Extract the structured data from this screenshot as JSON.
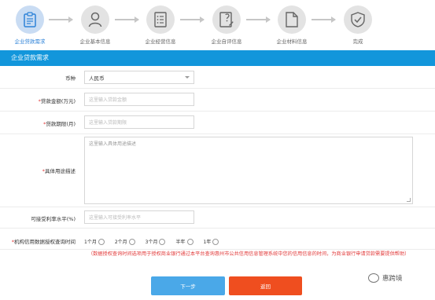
{
  "steps": [
    {
      "label": "企业贷款需求",
      "icon": "clipboard-icon",
      "active": true
    },
    {
      "label": "企业基本信息",
      "icon": "person-icon",
      "active": false
    },
    {
      "label": "企业经营信息",
      "icon": "list-document-icon",
      "active": false
    },
    {
      "label": "企业自评信息",
      "icon": "edit-document-icon",
      "active": false
    },
    {
      "label": "企业材料信息",
      "icon": "file-icon",
      "active": false
    },
    {
      "label": "完成",
      "icon": "shield-check-icon",
      "active": false
    }
  ],
  "section_title": "企业贷款需求",
  "form": {
    "currency": {
      "label": "币种",
      "value": "人民币"
    },
    "amount": {
      "required_mark": "*",
      "label": "贷款金额(万元)",
      "placeholder": "这里输入贷款金额"
    },
    "term": {
      "required_mark": "*",
      "label": "贷款期限(月)",
      "placeholder": "这里输入贷款期限"
    },
    "purpose": {
      "required_mark": "*",
      "label": "具体用途描述",
      "placeholder": "这里输入具体用途描述"
    },
    "interest": {
      "label": "可接受利率水平(%)",
      "placeholder": "这里输入可接受利率水平"
    },
    "authorization": {
      "required_mark": "*",
      "label": "机构信用数据授权查询时间",
      "options": [
        "1个月",
        "2个月",
        "3个月",
        "半年",
        "1年"
      ]
    },
    "note": "（数据授权查询时间选项用于授权商业银行通过本平台查询惠州市公共信用信息管理系统中您的信用信息的时间，为商业银行申请贷款需要提供帮助）"
  },
  "buttons": {
    "next": "下一步",
    "back": "返回"
  },
  "watermark": "惠跨境",
  "colors": {
    "accent": "#1296db",
    "next_button": "#4aa8e8",
    "back_button": "#ef4e1f",
    "required": "#e23b3b"
  }
}
